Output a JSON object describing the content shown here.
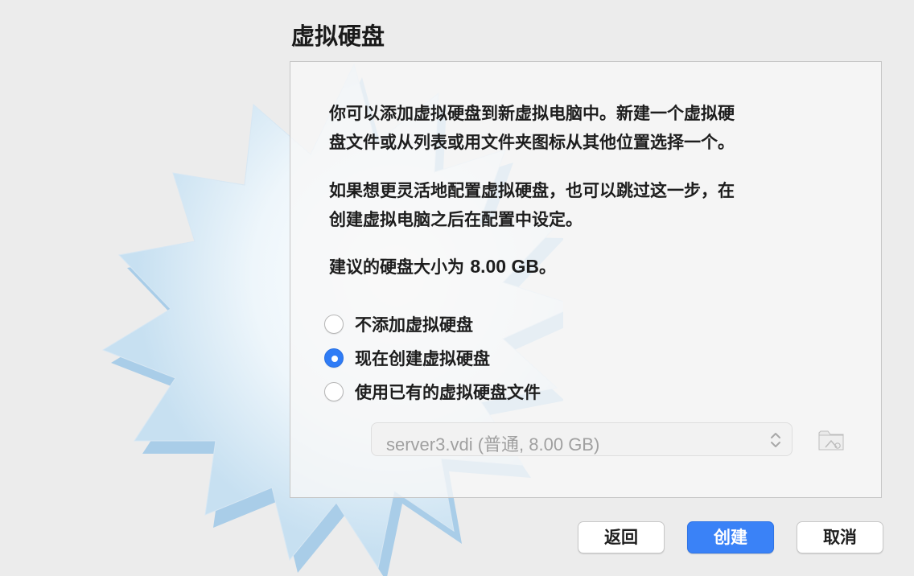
{
  "dialog": {
    "title": "虚拟硬盘",
    "intro_line1": "你可以添加虚拟硬盘到新虚拟电脑中。新建一个虚拟硬",
    "intro_line2": "盘文件或从列表或用文件夹图标从其他位置选择一个。",
    "note_line1": "如果想更灵活地配置虚拟硬盘，也可以跳过这一步，在",
    "note_line2": "创建虚拟电脑之后在配置中设定。",
    "recommend_prefix": "建议的硬盘大小为 ",
    "recommend_size": "8.00 GB",
    "recommend_suffix": "。"
  },
  "options": {
    "none_label": "不添加虚拟硬盘",
    "create_label": "现在创建虚拟硬盘",
    "existing_label": "使用已有的虚拟硬盘文件",
    "selected": "现在创建虚拟硬盘"
  },
  "disk_select": {
    "value": "server3.vdi (普通, 8.00 GB)",
    "enabled": false
  },
  "buttons": {
    "back": "返回",
    "create": "创建",
    "cancel": "取消"
  },
  "icons": {
    "background": "starburst-icon",
    "chevron": "up-down-chevron-icon",
    "folder": "folder-icon"
  },
  "colors": {
    "accent": "#3a82f7",
    "window_bg": "#ececec",
    "disabled_text": "#a0a0a0"
  }
}
